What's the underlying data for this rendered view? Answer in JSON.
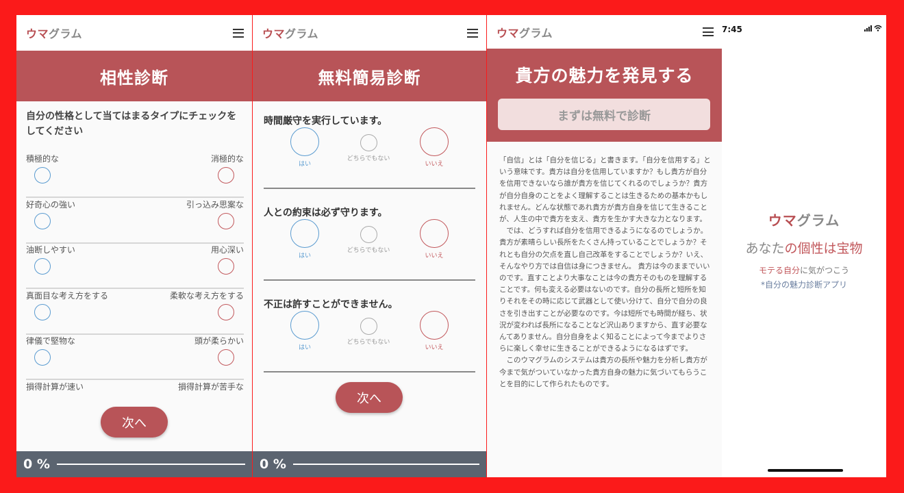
{
  "app": {
    "logo_accent": "ウマ",
    "logo_rest": "グラム"
  },
  "colors": {
    "accent": "#b85458",
    "blue": "#5a9bd0",
    "progress_bg": "#5b6470",
    "frame": "#fb1a1a"
  },
  "compat": {
    "banner": "相性診断",
    "intro": "自分の性格として当てはまるタイプにチェックをしてください",
    "pairs": [
      {
        "left": "積極的な",
        "right": "消極的な"
      },
      {
        "left": "好奇心の強い",
        "right": "引っ込み思案な"
      },
      {
        "left": "油断しやすい",
        "right": "用心深い"
      },
      {
        "left": "真面目な考え方をする",
        "right": "柔軟な考え方をする"
      },
      {
        "left": "律儀で堅物な",
        "right": "頭が柔らかい"
      },
      {
        "left": "損得計算が速い",
        "right": "損得計算が苦手な"
      }
    ],
    "next": "次へ",
    "progress": "0 %",
    "progress_value": 0
  },
  "quick": {
    "banner": "無料簡易診断",
    "questions": [
      {
        "text": "時間厳守を実行しています。",
        "yes": "はい",
        "neutral": "どちらでもない",
        "no": "いいえ"
      },
      {
        "text": "人との約束は必ず守ります。",
        "yes": "はい",
        "neutral": "どちらでもない",
        "no": "いいえ"
      },
      {
        "text": "不正は許すことができません。",
        "yes": "はい",
        "neutral": "どちらでもない",
        "no": "いいえ"
      }
    ],
    "next": "次へ",
    "progress": "0 %",
    "progress_value": 0
  },
  "discover": {
    "title": "貴方の魅力を発見する",
    "cta": "まずは無料で診断",
    "paragraphs": [
      "「自信」とは「自分を信じる」と書きます。「自分を信用する」という意味です。貴方は自分を信用していますか？もし貴方が自分を信用できないなら誰が貴方を信じてくれるのでしょうか？貴方が自分自身のことをよく理解することは生きるための基本かもしれません。どんな状態であれ貴方が貴方自身を信じて生きることが、人生の中で貴方を支え、貴方を生かす大きな力となります。",
      "では、どうすれば自分を信用できるようになるのでしょうか。貴方が素晴らしい長所をたくさん持っていることでしょうか？それとも自分の欠点を直し自己改革をすることでしょうか？いえ、そんなやり方では自信は身につきません。 貴方は今のままでいいのです。直すことより大事なことは今の貴方そのものを理解することです。何も変える必要はないのです。自分の長所と短所を知りそれをその時に応じて武器として使い分けて、自分で自分の良さを引き出すことが必要なのです。今は短所でも時間が経ち、状況が変われば長所になることなど沢山ありますから、直す必要なんてありません。自分自身をよく知ることによって今までよりさらに楽しく幸せに生きることができるようになるはずです。",
      "このウマグラムのシステムは貴方の長所や魅力を分析し貴方が今まで気がついていなかった貴方自身の魅力に気づいてもらうことを目的にして作られたものです。"
    ]
  },
  "splash": {
    "status_time": "7:45",
    "logo_accent": "ウマ",
    "logo_rest": "グラム",
    "tag_a": "あなた",
    "tag_b": "の個性は宝物",
    "sub_a": "モテる自分",
    "sub_b": "に気がつこう",
    "note": "*自分の魅力診断アプリ"
  }
}
